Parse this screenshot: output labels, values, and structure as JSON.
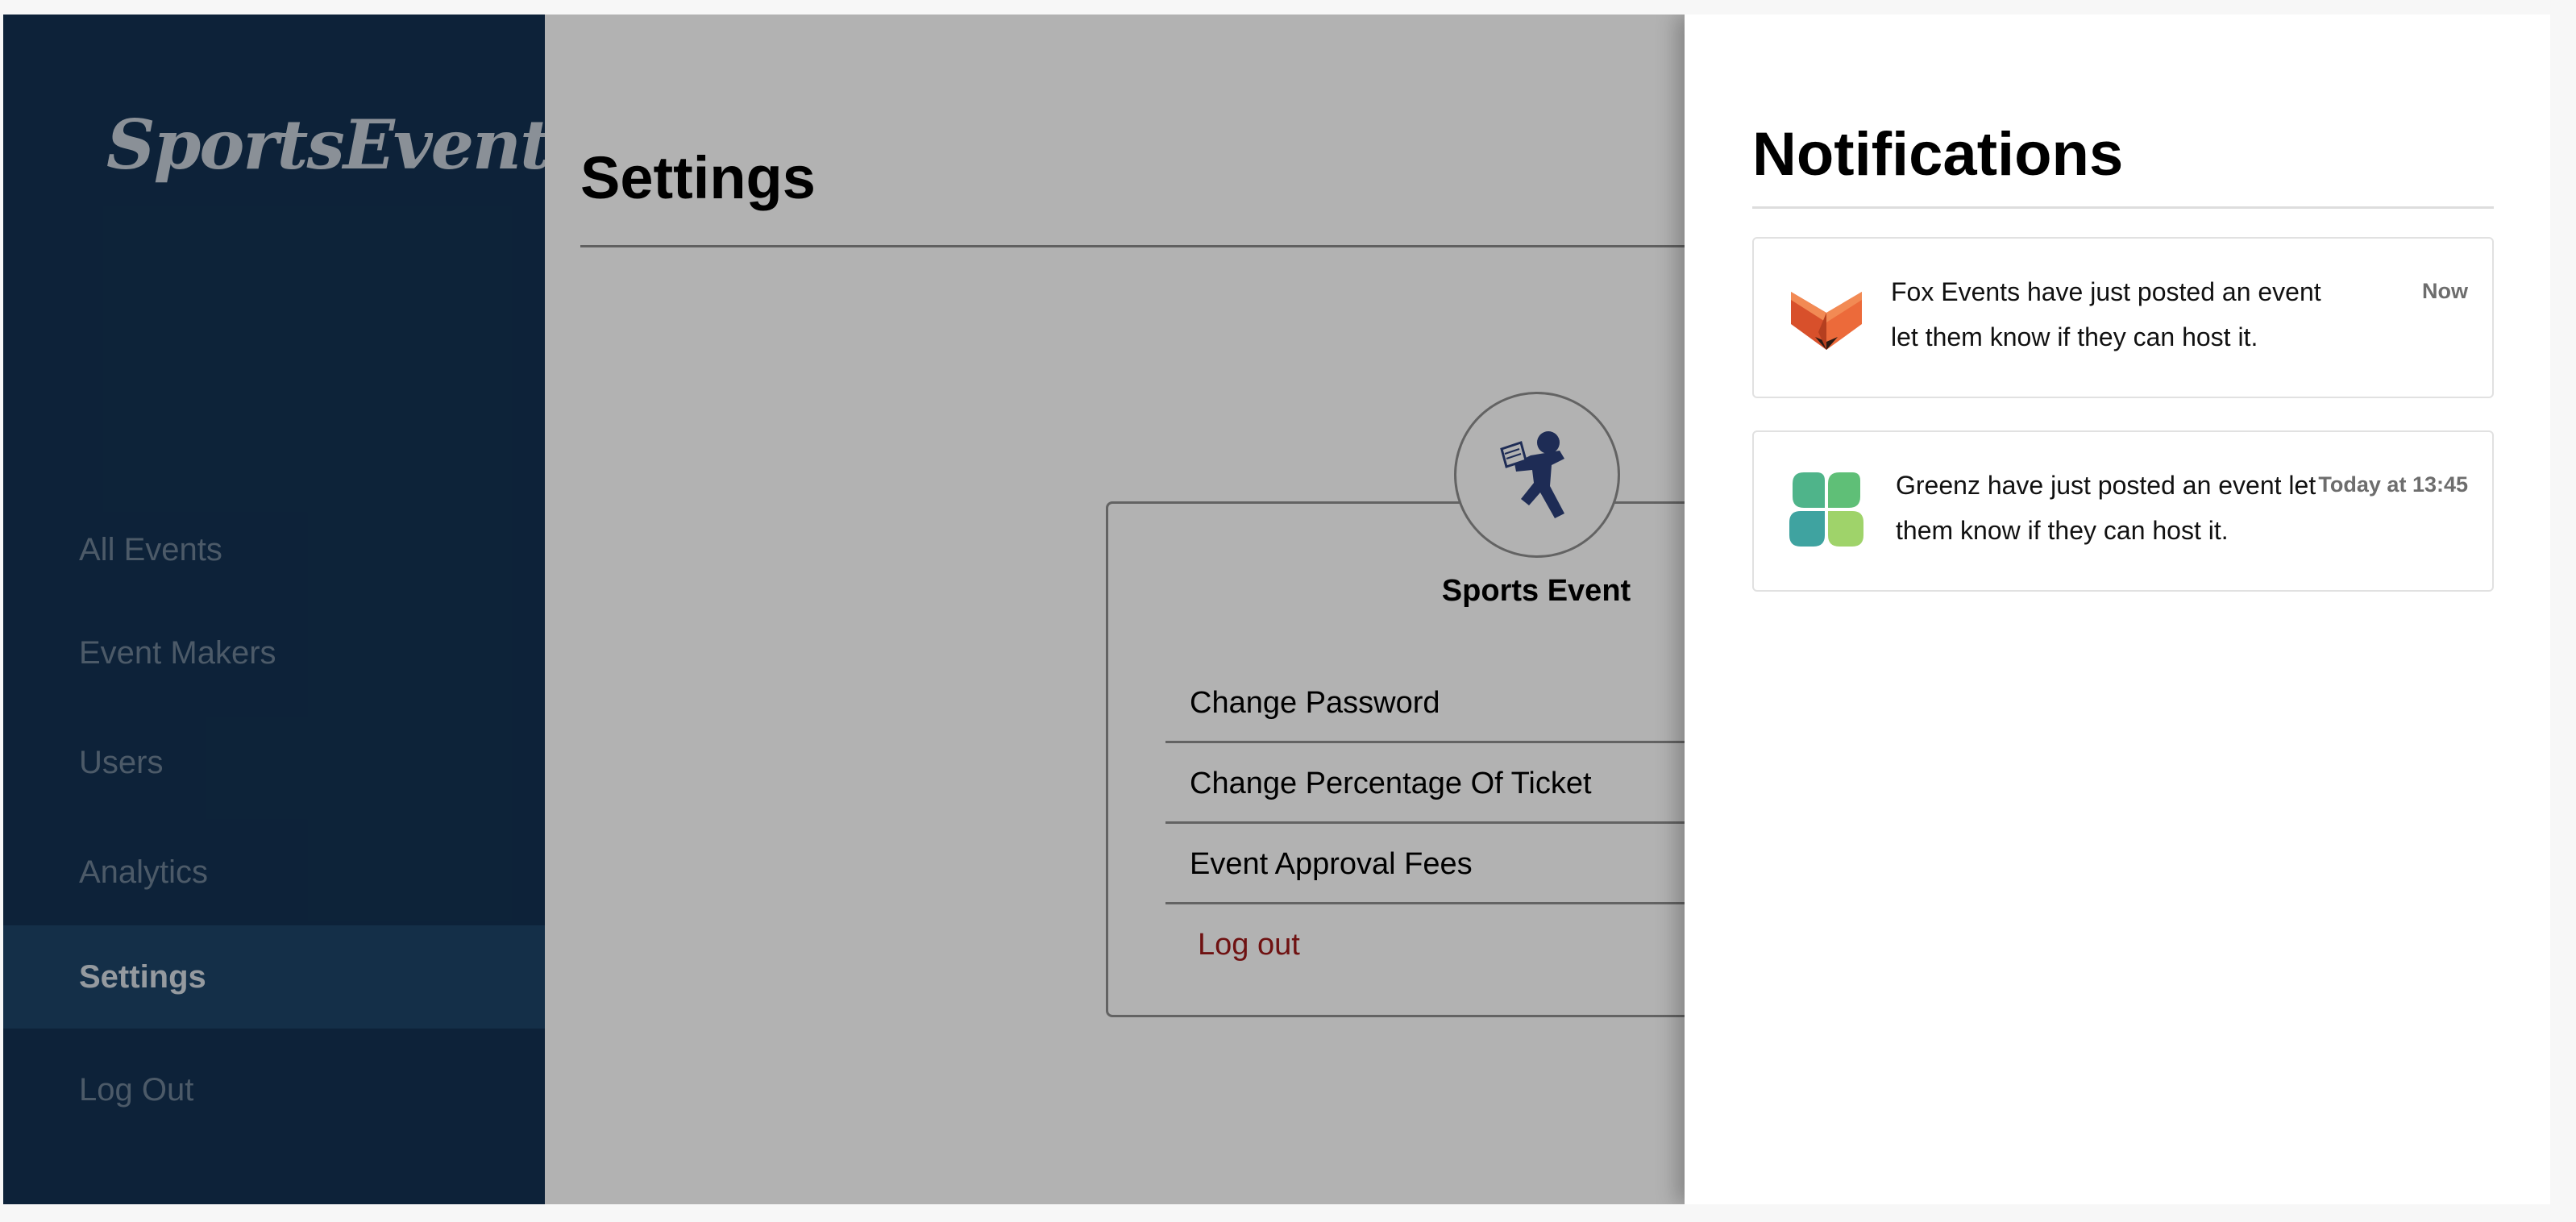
{
  "app": {
    "logo_text": "SportsEvent"
  },
  "sidebar": {
    "items": [
      {
        "label": "All Events"
      },
      {
        "label": "Event Makers"
      },
      {
        "label": "Users"
      },
      {
        "label": "Analytics"
      },
      {
        "label": "Settings",
        "active": true
      },
      {
        "label": "Log Out"
      }
    ]
  },
  "settings": {
    "title": "Settings",
    "profile_name": "Sports Event",
    "avatar_icon": "athlete-icon",
    "menu": [
      {
        "label": "Change Password"
      },
      {
        "label": "Change Percentage Of Ticket"
      },
      {
        "label": "Event Approval Fees"
      },
      {
        "label": "Log out"
      }
    ]
  },
  "notifications": {
    "title": "Notifications",
    "items": [
      {
        "icon": "fox-logo-icon",
        "text": "Fox Events have just posted an event let them know if they can host it.",
        "time": "Now"
      },
      {
        "icon": "clover-logo-icon",
        "text": "Greenz have just posted an event let them know if they can host it.",
        "time": "Today at 13:45"
      }
    ]
  },
  "colors": {
    "sidebar_bg": "#133252",
    "sidebar_active": "#1e4468",
    "logout_red": "#a01a1a",
    "brand_blue": "#2b3f7a"
  }
}
